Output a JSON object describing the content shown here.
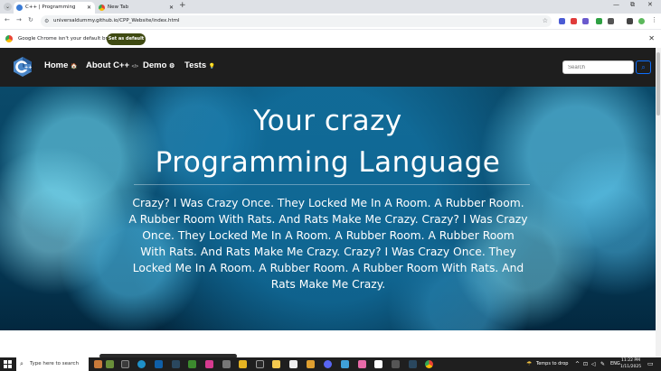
{
  "browser": {
    "tabs": [
      {
        "title": "C++ | Programming Language",
        "active": true
      },
      {
        "title": "New Tab",
        "active": false
      }
    ],
    "new_tab_symbol": "+",
    "close_symbol": "✕",
    "window_controls": [
      "—",
      "⧉",
      "✕"
    ],
    "url": "universaldummy.github.io/CPP_Website/index.html",
    "infobar": {
      "message": "Google Chrome isn't your default browser",
      "button_label": "Set as default"
    }
  },
  "site": {
    "nav": [
      {
        "label": "Home",
        "icon": "🏠"
      },
      {
        "label": "About C++",
        "icon": "</>"
      },
      {
        "label": "Demo",
        "icon": "⚙"
      },
      {
        "label": "Tests",
        "icon": "💡"
      }
    ],
    "search_placeholder": "Search",
    "hero": {
      "title_line1": "Your crazy",
      "title_line2": "Programming Language",
      "body": "Crazy? I Was Crazy Once. They Locked Me In A Room. A Rubber Room. A Rubber Room With Rats. And Rats Make Me Crazy. Crazy? I Was Crazy Once. They Locked Me In A Room. A Rubber Room. A Rubber Room With Rats. And Rats Make Me Crazy. Crazy? I Was Crazy Once. They Locked Me In A Room. A Rubber Room. A Rubber Room With Rats. And Rats Make Me Crazy."
    }
  },
  "taskbar": {
    "search_placeholder": "Type here to search",
    "weather": "Temps to drop",
    "language": "ENG",
    "time": "11:22 PM",
    "date": "1/11/2025"
  },
  "colors": {
    "navbar_bg": "#1e1e1e",
    "infobar_button_bg": "#3f4a12",
    "search_button": "#0d6efd"
  }
}
